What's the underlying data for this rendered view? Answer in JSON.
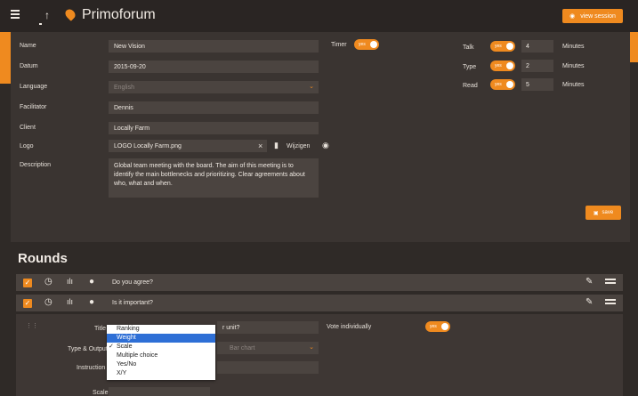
{
  "app": {
    "title": "Primoforum",
    "view_label": "view session"
  },
  "form": {
    "name_label": "Name",
    "name_value": "New Vision",
    "date_label": "Datum",
    "date_value": "2015-09-20",
    "language_label": "Language",
    "language_value": "English",
    "facilitator_label": "Facilitator",
    "facilitator_value": "Dennis",
    "client_label": "Client",
    "client_value": "Locally Farm",
    "logo_label": "Logo",
    "logo_value": "LOGO Locally Farm.png",
    "change_label": "Wijzigen",
    "description_label": "Description",
    "description_value": "Global team meeting with the board. The aim of this meeting is to identify the main bottlenecks and prioritizing. Clear agreements about who, what and when.",
    "timer_label": "Timer",
    "toggle_text": "yes",
    "talk_label": "Talk",
    "talk_value": "4",
    "type_label": "Type",
    "type_value": "2",
    "read_label": "Read",
    "read_value": "5",
    "minutes_label": "Minutes",
    "save_label": "save"
  },
  "rounds": {
    "title": "Rounds",
    "items": [
      {
        "text": "Do you agree?"
      },
      {
        "text": "Is it important?"
      }
    ],
    "detail": {
      "title_label": "Title",
      "title_value_fragment": "r unit?",
      "type_output_label": "Type & Output",
      "output_value": "Bar chart",
      "instruction_label": "Instruction",
      "vote_individually_label": "Vote individually",
      "bottom_label": "Scale"
    },
    "type_options": [
      "Ranking",
      "Weight",
      "Scale",
      "Multiple choice",
      "Yes/No",
      "X/Y"
    ],
    "type_highlighted": "Weight",
    "type_checked": "Scale"
  },
  "colors": {
    "accent": "#ef8a1f",
    "panel": "#3a3431",
    "field": "#4b4440",
    "highlight": "#2e6fd6"
  },
  "icons": [
    "menu-icon",
    "arrow-up-icon",
    "logo-drop-icon",
    "eye-icon",
    "save-icon",
    "file-icon",
    "clear-icon",
    "timer-icon",
    "bar-chart-icon",
    "user-icon",
    "pencil-icon",
    "drag-handle-icon",
    "checkmark-icon",
    "chevron-down-icon"
  ]
}
